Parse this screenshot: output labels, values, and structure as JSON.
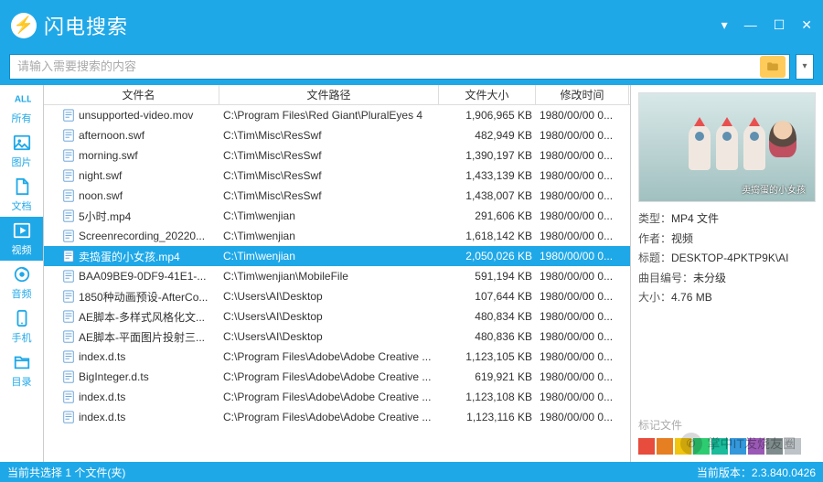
{
  "app": {
    "title": "闪电搜索"
  },
  "search": {
    "placeholder": "请输入需要搜索的内容"
  },
  "sidebar": [
    {
      "label": "所有",
      "icon": "all",
      "active": false
    },
    {
      "label": "图片",
      "icon": "image",
      "active": false
    },
    {
      "label": "文档",
      "icon": "doc",
      "active": false
    },
    {
      "label": "视频",
      "icon": "video",
      "active": true
    },
    {
      "label": "音频",
      "icon": "audio",
      "active": false
    },
    {
      "label": "手机",
      "icon": "phone",
      "active": false
    },
    {
      "label": "目录",
      "icon": "folder",
      "active": false
    }
  ],
  "columns": {
    "name": "文件名",
    "path": "文件路径",
    "size": "文件大小",
    "date": "修改时间"
  },
  "files": [
    {
      "name": "unsupported-video.mov",
      "path": "C:\\Program Files\\Red Giant\\PluralEyes 4",
      "size": "1,906,965 KB",
      "date": "1980/00/00 0...",
      "selected": false
    },
    {
      "name": "afternoon.swf",
      "path": "C:\\Tim\\Misc\\ResSwf",
      "size": "482,949 KB",
      "date": "1980/00/00 0...",
      "selected": false
    },
    {
      "name": "morning.swf",
      "path": "C:\\Tim\\Misc\\ResSwf",
      "size": "1,390,197 KB",
      "date": "1980/00/00 0...",
      "selected": false
    },
    {
      "name": "night.swf",
      "path": "C:\\Tim\\Misc\\ResSwf",
      "size": "1,433,139 KB",
      "date": "1980/00/00 0...",
      "selected": false
    },
    {
      "name": "noon.swf",
      "path": "C:\\Tim\\Misc\\ResSwf",
      "size": "1,438,007 KB",
      "date": "1980/00/00 0...",
      "selected": false
    },
    {
      "name": "5小时.mp4",
      "path": "C:\\Tim\\wenjian",
      "size": "291,606 KB",
      "date": "1980/00/00 0...",
      "selected": false
    },
    {
      "name": "Screenrecording_20220...",
      "path": "C:\\Tim\\wenjian",
      "size": "1,618,142 KB",
      "date": "1980/00/00 0...",
      "selected": false
    },
    {
      "name": "卖捣蛋的小女孩.mp4",
      "path": "C:\\Tim\\wenjian",
      "size": "2,050,026 KB",
      "date": "1980/00/00 0...",
      "selected": true
    },
    {
      "name": "BAA09BE9-0DF9-41E1-...",
      "path": "C:\\Tim\\wenjian\\MobileFile",
      "size": "591,194 KB",
      "date": "1980/00/00 0...",
      "selected": false
    },
    {
      "name": "1850种动画预设-AfterCo...",
      "path": "C:\\Users\\AI\\Desktop",
      "size": "107,644 KB",
      "date": "1980/00/00 0...",
      "selected": false
    },
    {
      "name": "AE脚本-多样式风格化文...",
      "path": "C:\\Users\\AI\\Desktop",
      "size": "480,834 KB",
      "date": "1980/00/00 0...",
      "selected": false
    },
    {
      "name": "AE脚本-平面图片投射三...",
      "path": "C:\\Users\\AI\\Desktop",
      "size": "480,836 KB",
      "date": "1980/00/00 0...",
      "selected": false
    },
    {
      "name": "index.d.ts",
      "path": "C:\\Program Files\\Adobe\\Adobe Creative ...",
      "size": "1,123,105 KB",
      "date": "1980/00/00 0...",
      "selected": false
    },
    {
      "name": "BigInteger.d.ts",
      "path": "C:\\Program Files\\Adobe\\Adobe Creative ...",
      "size": "619,921 KB",
      "date": "1980/00/00 0...",
      "selected": false
    },
    {
      "name": "index.d.ts",
      "path": "C:\\Program Files\\Adobe\\Adobe Creative ...",
      "size": "1,123,108 KB",
      "date": "1980/00/00 0...",
      "selected": false
    },
    {
      "name": "index.d.ts",
      "path": "C:\\Program Files\\Adobe\\Adobe Creative ...",
      "size": "1,123,116 KB",
      "date": "1980/00/00 0...",
      "selected": false
    }
  ],
  "preview": {
    "caption": "卖捣蛋的小女孩",
    "meta": {
      "type_label": "类型：",
      "type_val": "MP4 文件",
      "author_label": "作者：",
      "author_val": "视频",
      "title_label": "标题：",
      "title_val": "DESKTOP-4PKTP9K\\AI",
      "track_label": "曲目编号：",
      "track_val": "未分级",
      "size_label": "大小：",
      "size_val": "4.76 MB"
    },
    "tag_hint": "标记文件",
    "tag_colors": [
      "#e74c3c",
      "#e67e22",
      "#f1c40f",
      "#2ecc71",
      "#1abc9c",
      "#3498db",
      "#9b59b6",
      "#7f8c8d",
      "#bdc3c7"
    ]
  },
  "status": {
    "left": "当前共选择 1 个文件(夹)",
    "right": "当前版本：2.3.840.0426"
  },
  "watermark": "掌中IT发烧友圈"
}
